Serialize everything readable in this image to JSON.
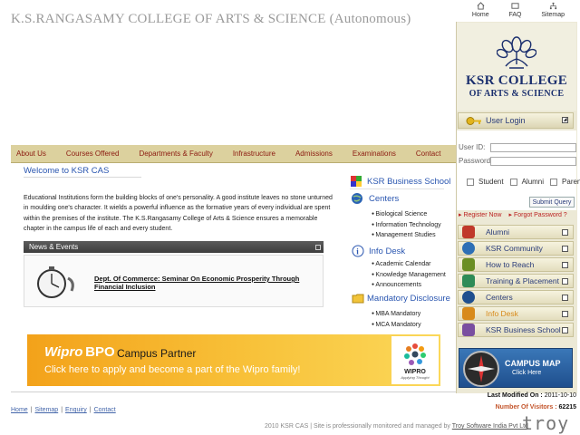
{
  "header": {
    "site_title": "K.S.RANGASAMY COLLEGE OF ARTS & SCIENCE (Autonomous)",
    "top_links": [
      {
        "label": "Home",
        "icon": "home-icon"
      },
      {
        "label": "FAQ",
        "icon": "faq-icon"
      },
      {
        "label": "Sitemap",
        "icon": "sitemap-icon"
      }
    ]
  },
  "logo": {
    "line1": "KSR COLLEGE",
    "line2": "OF ARTS & SCIENCE"
  },
  "nav": {
    "items": [
      "About Us",
      "Courses Offered",
      "Departments & Faculty",
      "Infrastructure",
      "Admissions",
      "Examinations",
      "Contact"
    ]
  },
  "main": {
    "welcome": "Welcome to KSR CAS",
    "intro": "Educational Institutions form the building blocks of one's personality. A good institute leaves no stone unturned in moulding one's character. It wields a powerful influence as the formative years of every individual are spent within the premises of the institute. The K.S.Rangasamy College of Arts & Science ensures a memorable chapter in the campus life of each and every student.",
    "news_title": "News & Events",
    "news_item": "Dept. Of Commerce: Seminar On Economic Prosperity Through Financial Inclusion"
  },
  "middle": {
    "business_school": "KSR Business School",
    "centers": {
      "title": "Centers",
      "items": [
        "Biological Science",
        "Information Technology",
        "Management Studies"
      ]
    },
    "info_desk": {
      "title": "Info Desk",
      "items": [
        "Academic Calendar",
        "Knowledge Management",
        "Announcements"
      ]
    },
    "mandatory": {
      "title": "Mandatory Disclosure",
      "items": [
        "MBA Mandatory",
        "MCA Mandatory"
      ]
    }
  },
  "banner": {
    "brand": "Wipro",
    "brand_suffix": "BPO",
    "partner": "Campus Partner",
    "cta": "Click here to apply and become a part of the Wipro family!",
    "logo_text": "WIPRO",
    "logo_tagline": "Applying Thought"
  },
  "login": {
    "title": "User Login",
    "user_id_label": "User ID:",
    "password_label": "Password:",
    "roles": [
      "Student",
      "Alumni",
      "Parent"
    ],
    "submit": "Submit Query",
    "register": "Register Now",
    "forgot": "Forgot Password ?"
  },
  "sidebar": {
    "items": [
      {
        "label": "Alumni",
        "icon": "alumni-icon",
        "color": "#c0392b"
      },
      {
        "label": "KSR Community",
        "icon": "community-icon",
        "color": "#2e6fb5"
      },
      {
        "label": "How to Reach",
        "icon": "reach-icon",
        "color": "#6b8e23"
      },
      {
        "label": "Training & Placement",
        "icon": "training-icon",
        "color": "#2e8b57"
      },
      {
        "label": "Centers",
        "icon": "centers-icon",
        "color": "#1f4f8e"
      },
      {
        "label": "Info Desk",
        "icon": "info-icon",
        "color": "#d88a1a"
      },
      {
        "label": "KSR Business School",
        "icon": "business-school-icon",
        "color": "#7a4fa0"
      }
    ]
  },
  "campus_map": {
    "title": "CAMPUS MAP",
    "sub": "Click Here"
  },
  "footer": {
    "links": [
      "Home",
      "Sitemap",
      "Enquiry",
      "Contact"
    ],
    "modified_label": "Last Modified On :",
    "modified_value": "2011-10-10",
    "visitors_label": "Number Of Visitors :",
    "visitors_value": "62215",
    "copyright_pre": "2010 KSR CAS | Site is professionally monitored and managed by",
    "copyright_link": "Troy Software India Pvt Ltd",
    "troy": "troy"
  },
  "colors": {
    "accent_blue": "#2a56b0",
    "nav_bg": "#dcd19e",
    "nav_text": "#8b1a10",
    "banner_orange": "#f3a21a"
  }
}
